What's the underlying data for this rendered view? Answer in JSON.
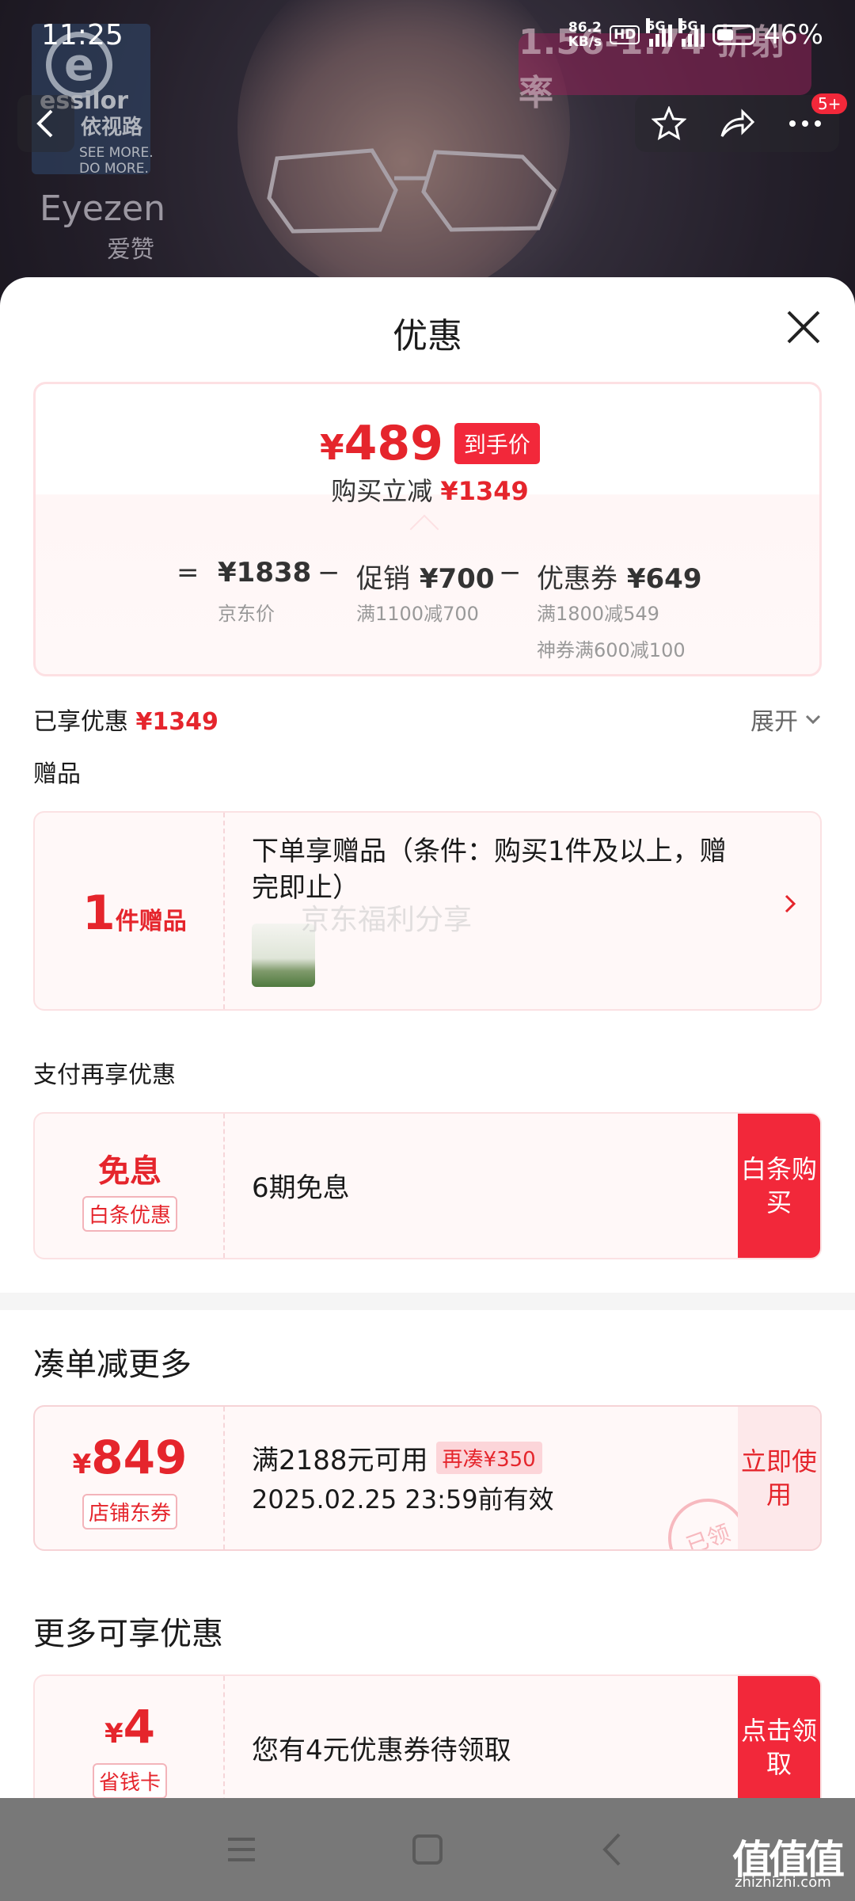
{
  "status_bar": {
    "time": "11:25",
    "net_speed_value": "86.2",
    "net_speed_unit": "KB/s",
    "hd": "HD",
    "network_1": "5G",
    "network_2": "5G",
    "battery": "46%"
  },
  "background": {
    "brand_logo": "e",
    "brand_name": "essilor",
    "brand_cn": "依视路",
    "brand_slogan_1": "SEE MORE.",
    "brand_slogan_2": "DO MORE.",
    "product_name": "Eyezen",
    "product_cn": "爱赞",
    "promo": "1.56-1.74 折射率",
    "cart_badge": "5+"
  },
  "sheet": {
    "title": "优惠",
    "price": {
      "currency": "¥",
      "final": "489",
      "final_tag": "到手价",
      "save_label": "购买立减",
      "save_amount": "¥1349",
      "equals": "=",
      "minus": "−",
      "jd_price": "¥1838",
      "jd_label": "京东价",
      "promo_label": "促销",
      "promo_amount": "¥700",
      "promo_rule": "满1100减700",
      "coupon_label": "优惠券",
      "coupon_amount": "¥649",
      "coupon_rule_1": "满1800减549",
      "coupon_rule_2": "神券满600减100"
    },
    "enjoyed_label": "已享优惠",
    "enjoyed_amount": "¥1349",
    "expand_label": "展开",
    "gift_section": "赠品",
    "gift": {
      "count": "1",
      "unit": "件赠品",
      "text": "下单享赠品（条件：购买1件及以上，赠完即止）"
    },
    "watermark": "京东福利分享",
    "pay_section": "支付再享优惠",
    "pay": {
      "title": "免息",
      "tag": "白条优惠",
      "text": "6期免息",
      "action": "白条购买"
    },
    "combine_section": "凑单减更多",
    "store_coupon": {
      "currency": "¥",
      "amount": "849",
      "tag": "店铺东券",
      "condition": "满2188元可用",
      "extra": "再凑¥350",
      "validity": "2025.02.25 23:59前有效",
      "action": "立即使用",
      "stamp": "已领"
    },
    "more_section": "更多可享优惠",
    "saver_card": {
      "currency": "¥",
      "amount": "4",
      "tag": "省钱卡",
      "text": "您有4元优惠券待领取",
      "action": "点击领取"
    }
  },
  "watermark_site": {
    "logo": "值值值",
    "url": "zhizhizhi.com"
  }
}
